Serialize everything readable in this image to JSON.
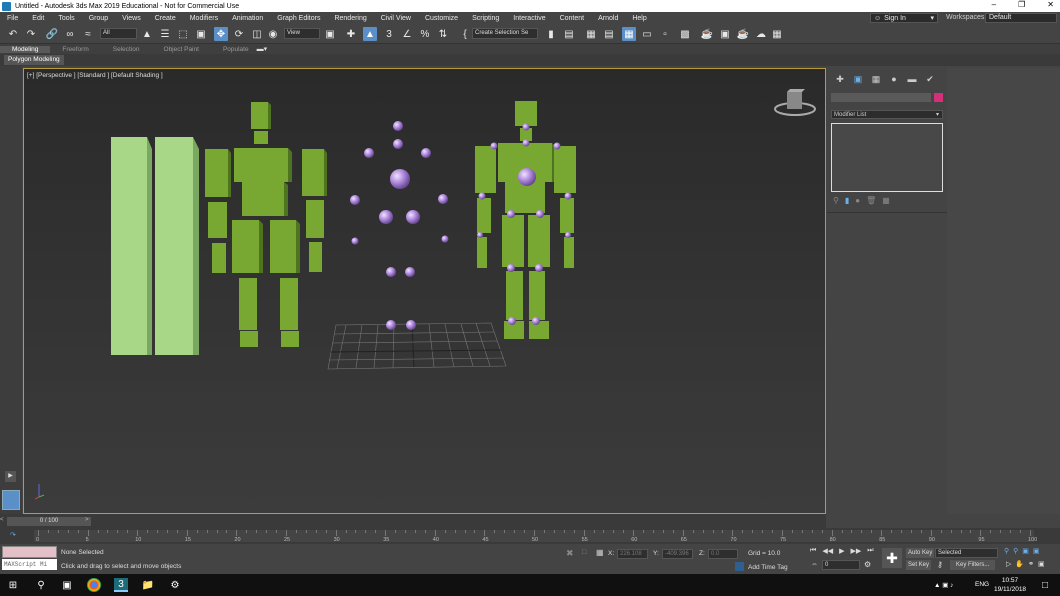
{
  "title": "Untitled - Autodesk 3ds Max 2019 Educational - Not for Commercial Use",
  "menu": [
    "File",
    "Edit",
    "Tools",
    "Group",
    "Views",
    "Create",
    "Modifiers",
    "Animation",
    "Graph Editors",
    "Rendering",
    "Civil View",
    "Customize",
    "Scripting",
    "Interactive",
    "Content",
    "Arnold",
    "Help"
  ],
  "signin": "Sign In",
  "workspaces_label": "Workspaces:",
  "workspace": "Default",
  "toolbar": {
    "filter": "All",
    "view": "View",
    "selection_set": "Create Selection Se"
  },
  "ribbon_tabs": [
    "Modeling",
    "Freeform",
    "Selection",
    "Object Paint",
    "Populate"
  ],
  "ribbon_selected": "Modeling",
  "ribbon_panel": "Polygon Modeling",
  "viewport_label": "[+] [Perspective ] [Standard ] [Default Shading ]",
  "command_panel": {
    "modifier_list": "Modifier List",
    "swatch_color": "#d4307a"
  },
  "timeslider": "0 / 100",
  "timeline_ticks": [
    "0",
    "5",
    "10",
    "15",
    "20",
    "25",
    "30",
    "35",
    "40",
    "45",
    "50",
    "55",
    "60",
    "65",
    "70",
    "75",
    "80",
    "85",
    "90",
    "95",
    "100"
  ],
  "status": {
    "selection": "None Selected",
    "prompt": "Click and drag to select and move objects",
    "maxscript": "MAXScript Mi",
    "x_label": "X:",
    "x": "226.108",
    "y_label": "Y:",
    "y": "-409.396",
    "z_label": "Z:",
    "z": "0.0",
    "grid": "Grid = 10.0",
    "add_time_tag": "Add Time Tag",
    "frame": "0",
    "auto_key": "Auto Key",
    "set_key": "Set Key",
    "key_mode": "Selected",
    "key_filters": "Key Filters..."
  },
  "taskbar": {
    "lang": "ENG",
    "time": "10:57",
    "date": "19/11/2018"
  },
  "colors": {
    "accent": "#5b8fc7",
    "viewport_border": "#b89b3a",
    "box_green": "#78a832",
    "pillar_green": "#a8d887",
    "sphere_purple": "#b48ee0"
  }
}
